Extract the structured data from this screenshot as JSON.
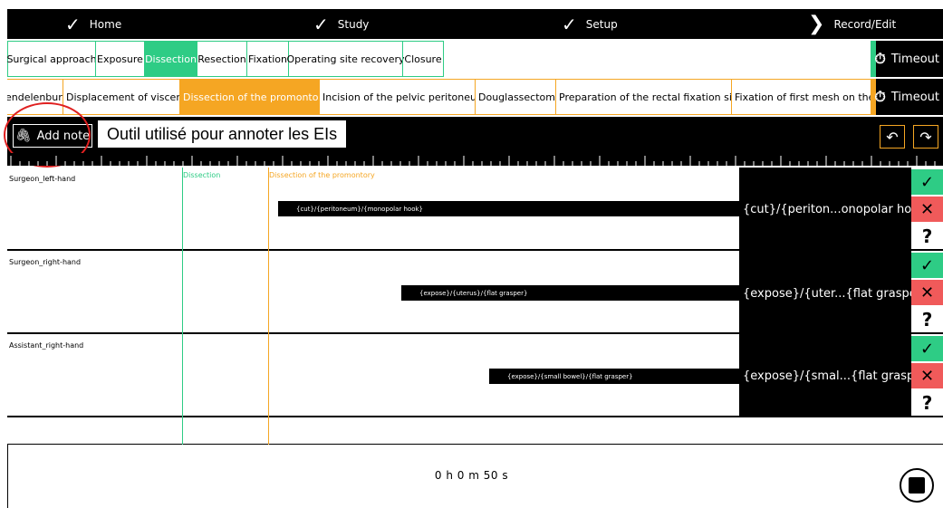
{
  "nav": {
    "items": [
      {
        "label": "Home",
        "icon": "check-icon"
      },
      {
        "label": "Study",
        "icon": "check-icon"
      },
      {
        "label": "Setup",
        "icon": "check-icon"
      },
      {
        "label": "Record/Edit",
        "icon": "chevron-right-icon"
      }
    ]
  },
  "phases": {
    "tabs": [
      {
        "label": "Surgical approach"
      },
      {
        "label": "Exposure"
      },
      {
        "label": "Dissection",
        "active": true
      },
      {
        "label": "Resection"
      },
      {
        "label": "Fixation"
      },
      {
        "label": "Operating site recovery"
      },
      {
        "label": "Closure"
      }
    ],
    "timeout_label": "Timeout"
  },
  "steps": {
    "tabs": [
      {
        "label": "endelenburg"
      },
      {
        "label": "Displacement of viscera"
      },
      {
        "label": "Dissection of the promontory",
        "active": true
      },
      {
        "label": "Incision of the pelvic peritoneum"
      },
      {
        "label": "Douglassectomy"
      },
      {
        "label": "Preparation of the rectal fixation site"
      },
      {
        "label": "Fixation of first mesh on the l"
      }
    ],
    "timeout_label": "Timeout"
  },
  "note_bar": {
    "add_note_label": "Add note",
    "annotation_text": "Outil utilisé pour annoter les EIs"
  },
  "timeline": {
    "phase_marker": "Dissection",
    "step_marker": "Dissection of the promontory",
    "tracks": [
      {
        "label": "Surgeon_left-hand",
        "event": "{cut}/{peritoneum}/{monopolar hook}",
        "summary": "{cut}/{periton...onopolar hook}"
      },
      {
        "label": "Surgeon_right-hand",
        "event": "{expose}/{uterus}/{flat grasper}",
        "summary": "{expose}/{uter...{flat grasper}"
      },
      {
        "label": "Assistant_right-hand",
        "event": "{expose}/{small bowel}/{flat grasper}",
        "summary": "{expose}/{smal...{flat grasper}"
      }
    ]
  },
  "timer": "0 h 0 m 50 s",
  "colors": {
    "phase_accent": "#2ecc85",
    "step_accent": "#f5a623",
    "reject": "#f05a5a"
  }
}
